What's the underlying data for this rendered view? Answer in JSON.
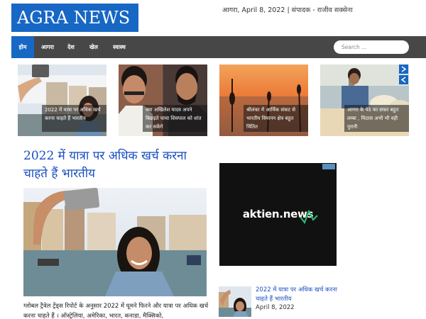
{
  "header": {
    "logo": "AGRA NEWS",
    "dateline": "आगरा, April 8, 2022 | संपादक - राजीव सक्सेना"
  },
  "nav": {
    "items": [
      "होम",
      "आगरा",
      "देश",
      "खेल",
      "स्वास्थ"
    ],
    "search_placeholder": "Search ..."
  },
  "featured": [
    {
      "title": "2022 में यात्रा पर अधिक खर्च करना चाहते हैं भारतीय"
    },
    {
      "title": "क्या अखिलेश यादव अपने बिछड़ते चाचा शिवपाल को शांत कर सकेंगे"
    },
    {
      "title": "श्रीलंका में आर्थिक संकट से भारतीय विमानन क्षेत्र बहुत चिंतित"
    },
    {
      "title": "आगरा के पेठे का सफर बहुत लम्बा , मिठास अभी भी वही पुरानी"
    }
  ],
  "main": {
    "title": "2022 में यात्रा पर अधिक खर्च करना चाहते हैं भारतीय",
    "excerpt": "ग्लोबल ट्रैवेल ट्रेंड्स रिपोर्ट के अनुसार 2022 में घूमने फिरने और यात्रा पर अधिक खर्च करना चाहते हैं । ऑस्ट्रेलिया, अमेरिका, भारत, कनाडा, मैक्सिको,"
  },
  "ad": {
    "brand": "aktien.news"
  },
  "sidebar": {
    "post_title": "2022 में यात्रा पर अधिक खर्च करना चाहते हैं भारतीय",
    "post_date": "April 8, 2022"
  },
  "colors": {
    "brand_blue": "#1767c4",
    "nav_bg": "#474747",
    "link": "#1a4ec0"
  },
  "icons": [
    "arrow-right-icon",
    "arrow-left-icon"
  ]
}
